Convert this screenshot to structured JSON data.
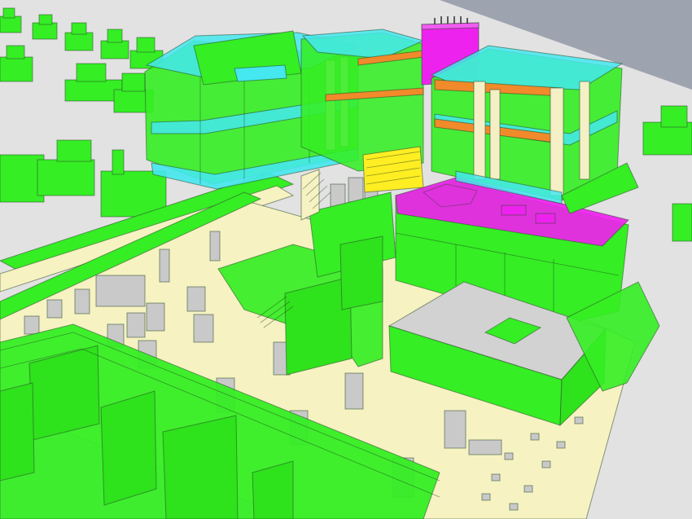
{
  "view": {
    "kind": "3d-bim-structural-model",
    "background_colors": {
      "sky": "#9aa0b0",
      "ground": "#e3e3e3"
    }
  },
  "materials": {
    "foundation_walls": "#33ee22",
    "slabs_cyan": "#44e8ee",
    "slab_floor_cream": "#f6f2c2",
    "columns_cream": "#f4efc4",
    "beams_orange": "#f08a2a",
    "stair_core_magenta": "#ee22ee",
    "ramp_yellow": "#ffee22",
    "pile_caps_gray": "#c8c8c8",
    "roof_gray": "#d0d0d0"
  },
  "icons": [
    "magenta-core-icon"
  ]
}
